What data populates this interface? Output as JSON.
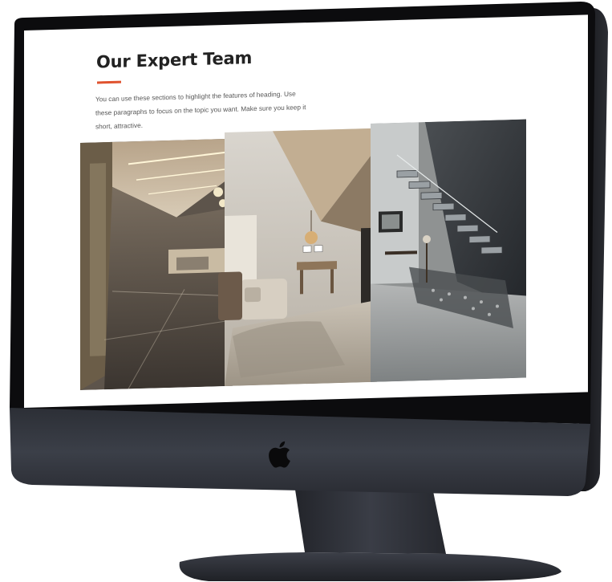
{
  "page": {
    "heading": "Our Expert Team",
    "body_text": "You can use these sections to highlight the features of heading. Use these paragraphs to focus on the topic you want. Make sure you keep it short, attractive."
  },
  "device": {
    "logo": "apple-logo-icon"
  },
  "gallery": {
    "images": [
      "interior-hallway-image",
      "living-room-image",
      "staircase-image"
    ]
  },
  "colors": {
    "accent": "#e0532f",
    "bezel": "#0d0d0f",
    "chin": "#3a3d45",
    "stand": "#2e3038"
  }
}
